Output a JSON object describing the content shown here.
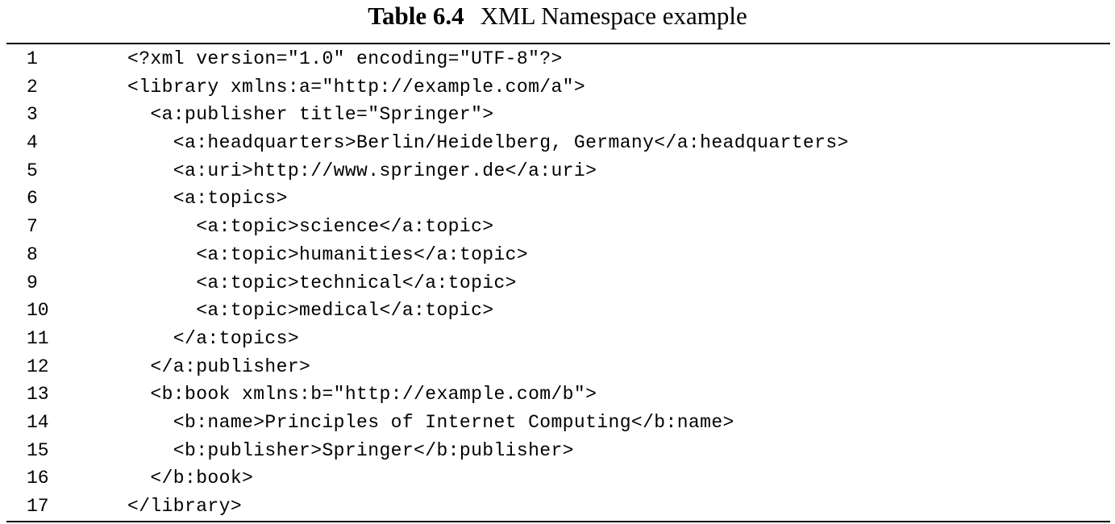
{
  "caption": {
    "label": "Table 6.4",
    "title": "XML Namespace example"
  },
  "lines": [
    {
      "number": "1",
      "code": "<?xml version=\"1.0\" encoding=\"UTF-8\"?>"
    },
    {
      "number": "2",
      "code": "<library xmlns:a=\"http://example.com/a\">"
    },
    {
      "number": "3",
      "code": "  <a:publisher title=\"Springer\">"
    },
    {
      "number": "4",
      "code": "    <a:headquarters>Berlin/Heidelberg, Germany</a:headquarters>"
    },
    {
      "number": "5",
      "code": "    <a:uri>http://www.springer.de</a:uri>"
    },
    {
      "number": "6",
      "code": "    <a:topics>"
    },
    {
      "number": "7",
      "code": "      <a:topic>science</a:topic>"
    },
    {
      "number": "8",
      "code": "      <a:topic>humanities</a:topic>"
    },
    {
      "number": "9",
      "code": "      <a:topic>technical</a:topic>"
    },
    {
      "number": "10",
      "code": "      <a:topic>medical</a:topic>"
    },
    {
      "number": "11",
      "code": "    </a:topics>"
    },
    {
      "number": "12",
      "code": "  </a:publisher>"
    },
    {
      "number": "13",
      "code": "  <b:book xmlns:b=\"http://example.com/b\">"
    },
    {
      "number": "14",
      "code": "    <b:name>Principles of Internet Computing</b:name>"
    },
    {
      "number": "15",
      "code": "    <b:publisher>Springer</b:publisher>"
    },
    {
      "number": "16",
      "code": "  </b:book>"
    },
    {
      "number": "17",
      "code": "</library>"
    }
  ]
}
